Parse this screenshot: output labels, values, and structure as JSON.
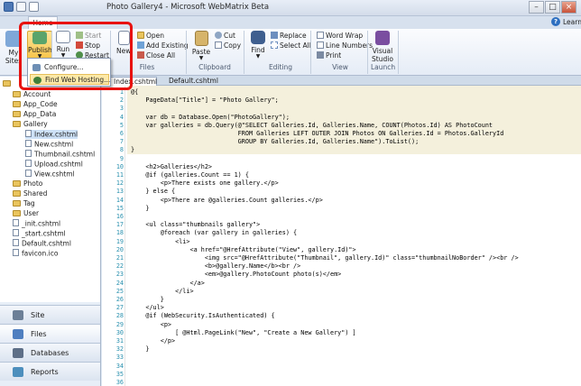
{
  "window": {
    "title": "Photo Gallery4 - Microsoft WebMatrix Beta",
    "ribbon_tab": "Home",
    "help_icon": "?",
    "learn_online": "Learn Online"
  },
  "ribbon": {
    "site": {
      "my_sites": "My Sites",
      "publish": "Publish"
    },
    "run": {
      "run": "Run",
      "start": "Start",
      "stop": "Stop",
      "restart": "Restart"
    },
    "files": {
      "new": "New",
      "open": "Open",
      "add_existing": "Add Existing",
      "close_all": "Close All",
      "label": "Files"
    },
    "clipboard": {
      "paste": "Paste",
      "cut": "Cut",
      "copy": "Copy",
      "label": "Clipboard"
    },
    "editing": {
      "find": "Find",
      "replace": "Replace",
      "select_all": "Select All",
      "label": "Editing"
    },
    "view": {
      "word_wrap": "Word Wrap",
      "line_numbers": "Line Numbers",
      "print": "Print",
      "label": "View"
    },
    "launch": {
      "visual_studio": "Visual Studio",
      "label": "Launch"
    }
  },
  "publish_menu": {
    "items": [
      "Configure...",
      "Find Web Hosting..."
    ]
  },
  "tree": {
    "root": "",
    "items": [
      {
        "label": "Account",
        "type": "folder"
      },
      {
        "label": "App_Code",
        "type": "folder"
      },
      {
        "label": "App_Data",
        "type": "folder"
      },
      {
        "label": "Gallery",
        "type": "folder"
      },
      {
        "label": "Index.cshtml",
        "type": "file"
      },
      {
        "label": "New.cshtml",
        "type": "file"
      },
      {
        "label": "Thumbnail.cshtml",
        "type": "file"
      },
      {
        "label": "Upload.cshtml",
        "type": "file"
      },
      {
        "label": "View.cshtml",
        "type": "file"
      },
      {
        "label": "Photo",
        "type": "folder"
      },
      {
        "label": "Shared",
        "type": "folder"
      },
      {
        "label": "Tag",
        "type": "folder"
      },
      {
        "label": "User",
        "type": "folder"
      },
      {
        "label": "_init.cshtml",
        "type": "file"
      },
      {
        "label": "_start.cshtml",
        "type": "file"
      },
      {
        "label": "Default.cshtml",
        "type": "file"
      },
      {
        "label": "favicon.ico",
        "type": "file"
      }
    ]
  },
  "workspaces": [
    "Site",
    "Files",
    "Databases",
    "Reports"
  ],
  "doc_tabs": [
    "Index.cshtml",
    "Default.cshtml"
  ],
  "code": {
    "line_numbers": [
      "1",
      "2",
      "3",
      "4",
      "5",
      "6",
      "7",
      "8",
      "9",
      "10",
      "11",
      "12",
      "13",
      "14",
      "15",
      "16",
      "17",
      "18",
      "19",
      "20",
      "21",
      "22",
      "23",
      "24",
      "25",
      "26",
      "27",
      "28",
      "29",
      "30",
      "31",
      "32",
      "33",
      "34",
      "35",
      "36"
    ],
    "lines": [
      "@{",
      "    PageData[\"Title\"] = \"Photo Gallery\";",
      "",
      "    var db = Database.Open(\"PhotoGallery\");",
      "    var galleries = db.Query(@\"SELECT Galleries.Id, Galleries.Name, COUNT(Photos.Id) AS PhotoCount",
      "                             FROM Galleries LEFT OUTER JOIN Photos ON Galleries.Id = Photos.GalleryId",
      "                             GROUP BY Galleries.Id, Galleries.Name\").ToList();",
      "}",
      "",
      "    <h2>Galleries</h2>",
      "    @if (galleries.Count == 1) {",
      "        <p>There exists one gallery.</p>",
      "    } else {",
      "        <p>There are @galleries.Count galleries.</p>",
      "    }",
      "",
      "    <ul class=\"thumbnails gallery\">",
      "        @foreach (var gallery in galleries) {",
      "            <li>",
      "                <a href=\"@HrefAttribute(\"View\", gallery.Id)\">",
      "                    <img src=\"@HrefAttribute(\"Thumbnail\", gallery.Id)\" class=\"thumbnailNoBorder\" /><br />",
      "                    <b>@gallery.Name</b><br />",
      "                    <em>@gallery.PhotoCount photo(s)</em>",
      "                </a>",
      "            </li>",
      "        }",
      "    </ul>",
      "    @if (WebSecurity.IsAuthenticated) {",
      "        <p>",
      "            [ @Html.PageLink(\"New\", \"Create a New Gallery\") ]",
      "        </p>",
      "    }",
      "",
      "",
      "",
      ""
    ]
  },
  "colors": {
    "highlight_box": "#e8120f",
    "code_block_bg": "#f4f0dc",
    "razor_marker": "#ffff00",
    "line_number": "#2b91af"
  }
}
